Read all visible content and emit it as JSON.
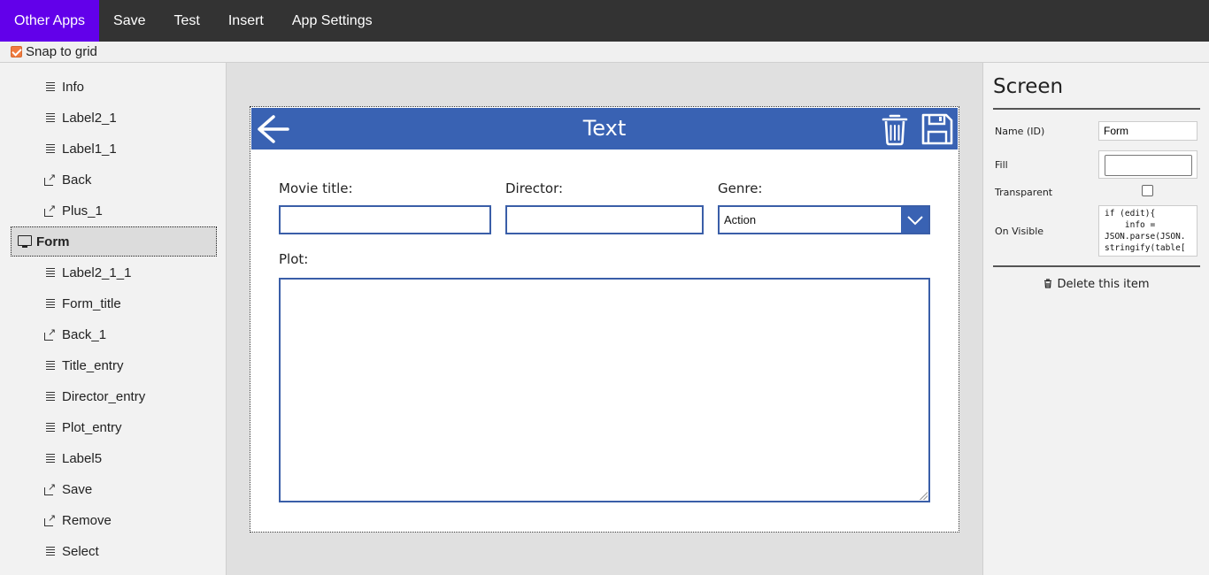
{
  "menu": {
    "items": [
      {
        "label": "Other Apps",
        "active": true
      },
      {
        "label": "Save"
      },
      {
        "label": "Test"
      },
      {
        "label": "Insert"
      },
      {
        "label": "App Settings"
      }
    ]
  },
  "snap": {
    "label": "Snap to grid",
    "checked": true
  },
  "tree": {
    "items": [
      {
        "label": "Info",
        "icon": "lines-icon"
      },
      {
        "label": "Label2_1",
        "icon": "lines-icon"
      },
      {
        "label": "Label1_1",
        "icon": "lines-icon"
      },
      {
        "label": "Back",
        "icon": "link-icon"
      },
      {
        "label": "Plus_1",
        "icon": "link-icon"
      },
      {
        "label": "Form",
        "icon": "monitor-icon",
        "selected": true
      },
      {
        "label": "Label2_1_1",
        "icon": "lines-icon"
      },
      {
        "label": "Form_title",
        "icon": "lines-icon"
      },
      {
        "label": "Back_1",
        "icon": "link-icon"
      },
      {
        "label": "Title_entry",
        "icon": "lines-icon"
      },
      {
        "label": "Director_entry",
        "icon": "lines-icon"
      },
      {
        "label": "Plot_entry",
        "icon": "lines-icon"
      },
      {
        "label": "Label5",
        "icon": "lines-icon"
      },
      {
        "label": "Save",
        "icon": "link-icon"
      },
      {
        "label": "Remove",
        "icon": "link-icon"
      },
      {
        "label": "Select",
        "icon": "lines-icon"
      }
    ]
  },
  "form": {
    "title": "Text",
    "header_color": "#3962b3",
    "movie_title_label": "Movie title:",
    "movie_title_value": "",
    "director_label": "Director:",
    "director_value": "",
    "genre_label": "Genre:",
    "genre_value": "Action",
    "plot_label": "Plot:",
    "plot_value": ""
  },
  "props": {
    "title": "Screen",
    "name_label": "Name (ID)",
    "name_value": "Form",
    "fill_label": "Fill",
    "transparent_label": "Transparent",
    "transparent_checked": false,
    "on_visible_label": "On Visible",
    "on_visible_code": "if (edit){\n    info =\nJSON.parse(JSON.\nstringify(table[",
    "delete_label": "Delete this item"
  },
  "colors": {
    "accent": "#6200ea",
    "menubar": "#333333",
    "form_blue": "#3962b3",
    "snap_check": "#f07b3f"
  }
}
